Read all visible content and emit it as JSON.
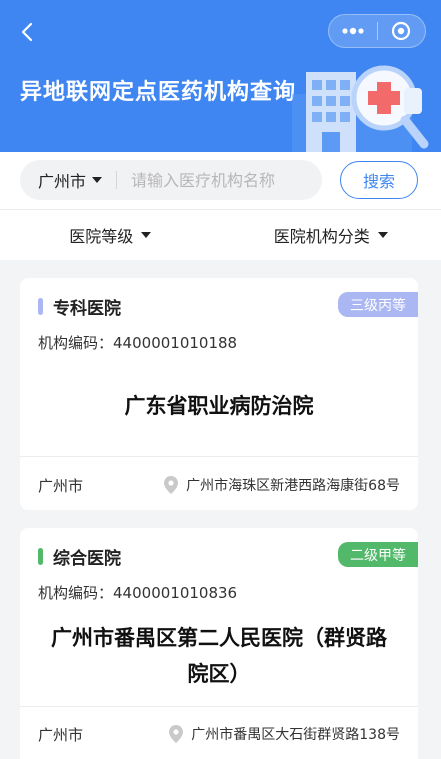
{
  "header": {
    "title": "异地联网定点医药机构查询",
    "back_icon": "chevron-left-icon",
    "more_icon": "more-dots-icon",
    "target_icon": "target-icon",
    "bg_color": "#3f86f2"
  },
  "search": {
    "city": "广州市",
    "placeholder": "请输入医疗机构名称",
    "button_label": "搜索"
  },
  "filters": [
    {
      "label": "医院等级"
    },
    {
      "label": "医院机构分类"
    }
  ],
  "cards": [
    {
      "type": "专科医院",
      "type_color": "#aab7f2",
      "level": "三级丙等",
      "level_color": "#aab7f2",
      "code_label": "机构编码：",
      "code": "4400001010188",
      "name": "广东省职业病防治院",
      "city": "广州市",
      "address": "广州市海珠区新港西路海康街68号"
    },
    {
      "type": "综合医院",
      "type_color": "#52b96a",
      "level": "二级甲等",
      "level_color": "#52b96a",
      "code_label": "机构编码：",
      "code": "4400001010836",
      "name_line1": "广州市番禺区第二人民医院（群贤路",
      "name_line2": "院区）",
      "city": "广州市",
      "address": "广州市番禺区大石街群贤路138号"
    }
  ]
}
